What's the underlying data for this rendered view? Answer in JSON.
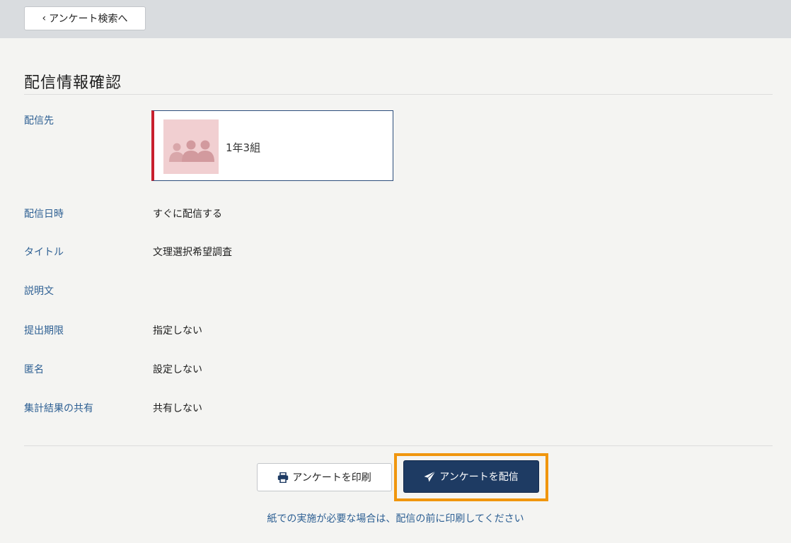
{
  "header": {
    "back_label": "アンケート検索へ"
  },
  "page": {
    "title": "配信情報確認"
  },
  "fields": {
    "destination": {
      "label": "配信先",
      "card_name": "1年3組"
    },
    "send_datetime": {
      "label": "配信日時",
      "value": "すぐに配信する"
    },
    "title": {
      "label": "タイトル",
      "value": "文理選択希望調査"
    },
    "description": {
      "label": "説明文",
      "value": ""
    },
    "deadline": {
      "label": "提出期限",
      "value": "指定しない"
    },
    "anonymous": {
      "label": "匿名",
      "value": "設定しない"
    },
    "result_sharing": {
      "label": "集計結果の共有",
      "value": "共有しない"
    }
  },
  "actions": {
    "print_label": "アンケートを印刷",
    "send_label": "アンケートを配信"
  },
  "footer": {
    "note": "紙での実施が必要な場合は、配信の前に印刷してください"
  },
  "icons": {
    "back": "chevron-left-icon",
    "print": "printer-icon",
    "send": "paper-plane-icon",
    "group": "group-people-icon"
  },
  "colors": {
    "label_blue": "#2d5f93",
    "primary_navy": "#1e3b63",
    "card_red_accent": "#c8202e",
    "highlight_orange": "#f0960e",
    "thumb_pink": "#f1cfd1"
  }
}
